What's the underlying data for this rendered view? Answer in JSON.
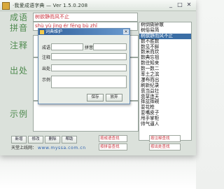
{
  "window": {
    "title": "·我爱成语字典 — Ver 1.5.0.208",
    "controls": [
      "_",
      "□",
      "✕"
    ]
  },
  "labels": {
    "idiom": "成语",
    "pinyin": "拼音",
    "meaning": "注释",
    "source": "出处",
    "example": "示例"
  },
  "fields": {
    "idiom_value": "树欲静而风不止",
    "pinyin_value": "shù  yù  jìng  ér  fēng  bù  zhǐ"
  },
  "idiom_list": {
    "items": [
      "树倒猢狲散",
      "树俗易简",
      "树欲静而风不止",
      "数不胜数",
      "数见不鲜",
      "数米而炊",
      "数典忘祖",
      "数往知来",
      "数一数二",
      "率土之滨",
      "瀑布而出",
      "刷新纪录",
      "衰当益壮",
      "衰草连天",
      "摔盆摔碗",
      "耍花枪",
      "耍嘴皮子",
      "甩手掌柜",
      "帅气逼人"
    ],
    "selected_index": 2
  },
  "buttons": {
    "add": "新增",
    "modify": "修改",
    "delete": "删除",
    "help": "帮助"
  },
  "search": {
    "by_idiom": "按成语查找",
    "by_pinyin": "按拼音查找",
    "by_meaning": "按注释查找",
    "by_source": "按出处查找"
  },
  "website": {
    "label": "天堂上线网：",
    "url": "www.myssa.com.cn"
  },
  "dialog": {
    "title": "词典维护",
    "fields": {
      "idiom": "成语",
      "pinyin": "拼音",
      "meaning": "注释",
      "source": "出处",
      "example": "示例"
    },
    "save": "保存",
    "cancel": "放弃"
  }
}
